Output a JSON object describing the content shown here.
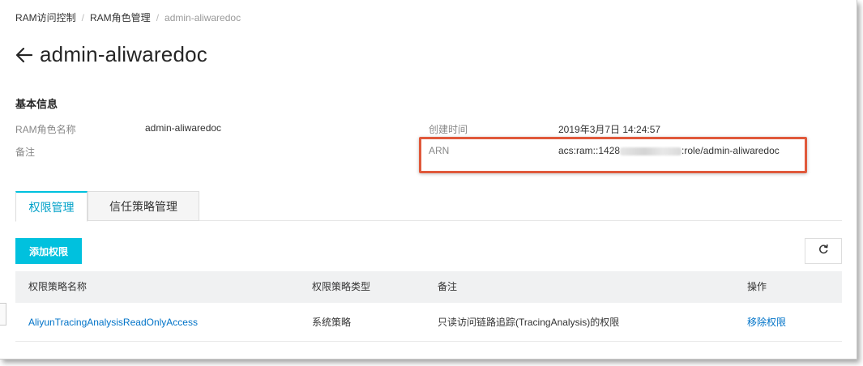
{
  "breadcrumb": {
    "items": [
      "RAM访问控制",
      "RAM角色管理"
    ],
    "current": "admin-aliwaredoc",
    "separator": "/"
  },
  "page": {
    "title": "admin-aliwaredoc"
  },
  "basic_info": {
    "section_title": "基本信息",
    "role_name_label": "RAM角色名称",
    "role_name_value": "admin-aliwaredoc",
    "note_label": "备注",
    "created_label": "创建时间",
    "created_value": "2019年3月7日 14:24:57",
    "arn_label": "ARN",
    "arn_prefix": "acs:ram::1428",
    "arn_suffix": ":role/admin-aliwaredoc"
  },
  "tabs": [
    {
      "label": "权限管理",
      "active": true
    },
    {
      "label": "信任策略管理",
      "active": false
    }
  ],
  "toolbar": {
    "add_label": "添加权限"
  },
  "table": {
    "headers": [
      "权限策略名称",
      "权限策略类型",
      "备注",
      "操作"
    ],
    "rows": [
      {
        "name": "AliyunTracingAnalysisReadOnlyAccess",
        "type": "系统策略",
        "note": "只读访问链路追踪(TracingAnalysis)的权限",
        "action": "移除权限"
      }
    ]
  },
  "colors": {
    "accent": "#00c1de",
    "link": "#0073c8",
    "highlight_box": "#e0593b"
  },
  "icons": {
    "back": "arrow-left-icon",
    "refresh": "refresh-icon"
  }
}
